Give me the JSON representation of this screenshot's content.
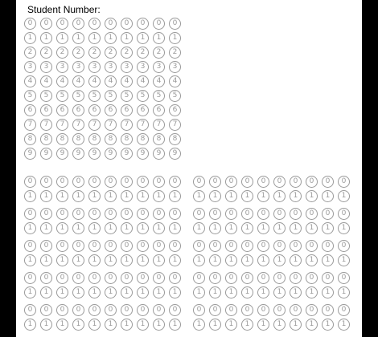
{
  "form": {
    "student_number_label": "Student Number:"
  },
  "student_number_grid": {
    "digit_rows": [
      "0",
      "1",
      "2",
      "3",
      "4",
      "5",
      "6",
      "7",
      "8",
      "9"
    ],
    "column_count": 10
  },
  "answer_blocks": [
    {
      "rows": [
        "0",
        "1"
      ],
      "column_count": 10
    },
    {
      "rows": [
        "0",
        "1"
      ],
      "column_count": 10
    },
    {
      "rows": [
        "0",
        "1"
      ],
      "column_count": 10
    },
    {
      "rows": [
        "0",
        "1"
      ],
      "column_count": 10
    },
    {
      "rows": [
        "0",
        "1"
      ],
      "column_count": 10
    },
    {
      "rows": [
        "0",
        "1"
      ],
      "column_count": 10
    },
    {
      "rows": [
        "0",
        "1"
      ],
      "column_count": 10
    },
    {
      "rows": [
        "0",
        "1"
      ],
      "column_count": 10
    },
    {
      "rows": [
        "0",
        "1"
      ],
      "column_count": 10
    },
    {
      "rows": [
        "0",
        "1"
      ],
      "column_count": 10
    }
  ],
  "colors": {
    "background": "#000000",
    "sheet": "#ffffff",
    "bubble_outline": "#9a9a9a",
    "label_text": "#000000"
  }
}
